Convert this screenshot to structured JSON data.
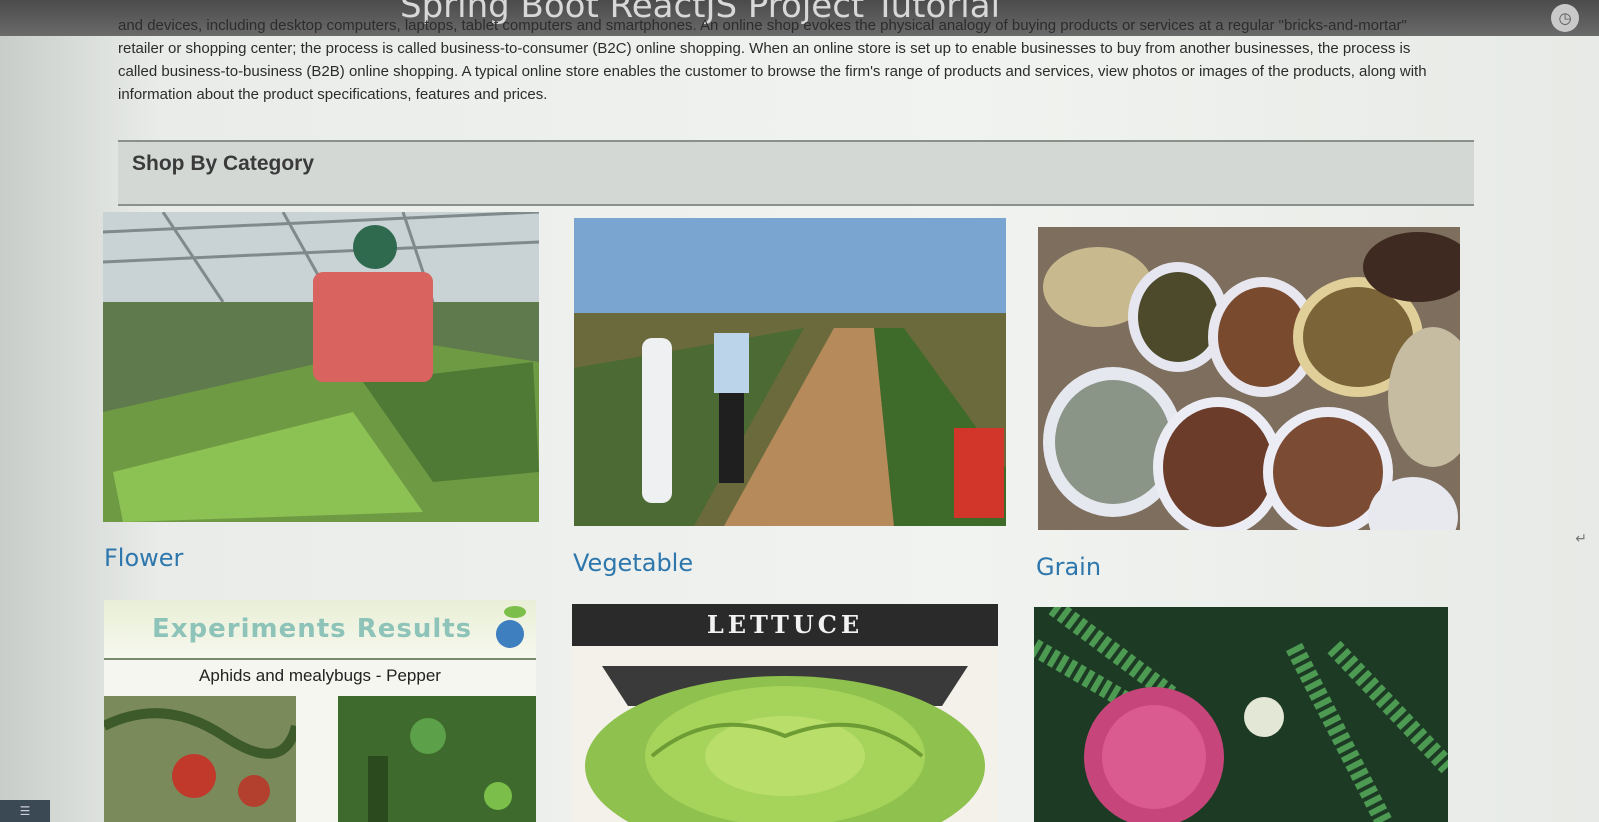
{
  "window": {
    "title": "Spring Boot ReactJS Project Tutorial"
  },
  "intro": {
    "text": "and devices, including desktop computers, laptops, tablet computers and smartphones. An online shop evokes the physical analogy of buying products or services at a regular \"bricks-and-mortar\" retailer or shopping center; the process is called business-to-consumer (B2C) online shopping. When an online store is set up to enable businesses to buy from another businesses, the process is called business-to-business (B2B) online shopping. A typical online store enables the customer to browse the firm's range of products and services, view photos or images of the products, along with information about the product specifications, features and prices."
  },
  "section": {
    "title": "Shop By Category"
  },
  "categories": [
    {
      "label": "Flower"
    },
    {
      "label": "Vegetable"
    },
    {
      "label": "Grain"
    }
  ],
  "cards": {
    "experiments_title": "Experiments Results",
    "experiments_subtitle": "Aphids and mealybugs - Pepper",
    "lettuce_title": "LETTUCE"
  },
  "icons": {
    "clock": "clock-icon",
    "leaf": "leaf-globe-icon",
    "cursor": "mouse-cursor-icon"
  },
  "colors": {
    "link": "#2e77ad",
    "header_bg": "#d3d8d5"
  }
}
